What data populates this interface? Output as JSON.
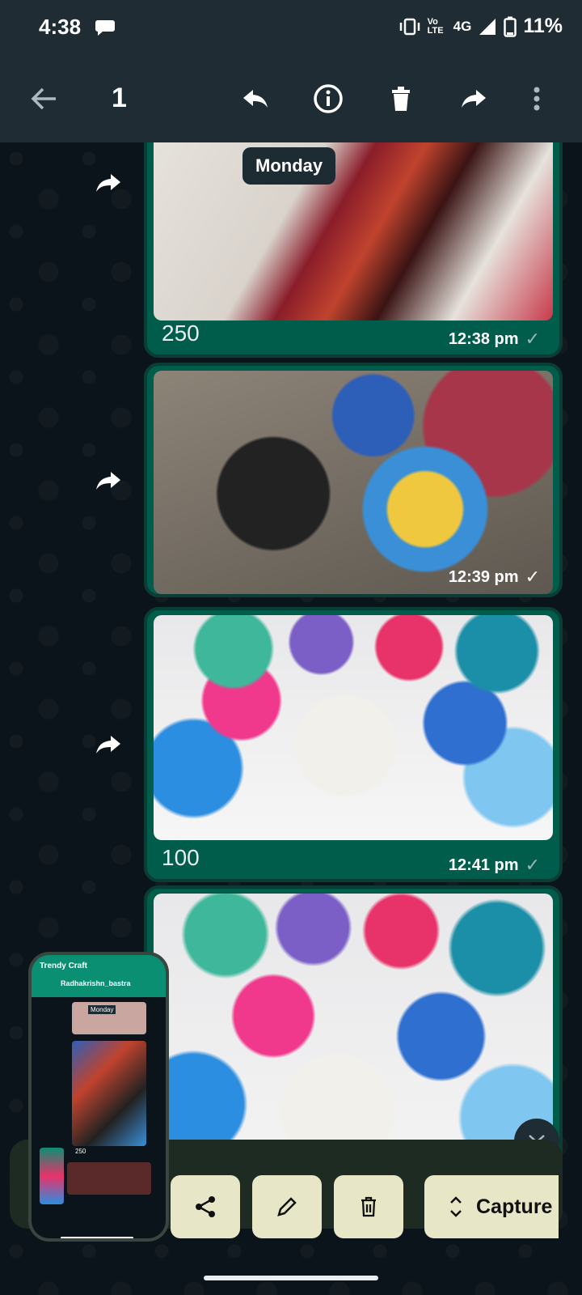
{
  "status_bar": {
    "time": "4:38",
    "network": "4G",
    "volte": "Vo LTE",
    "battery": "11%"
  },
  "app_bar": {
    "selected_count": "1"
  },
  "date_chip": "Monday",
  "messages": [
    {
      "caption": "250",
      "time": "12:38 pm"
    },
    {
      "caption": "",
      "time": "12:39 pm"
    },
    {
      "caption": "100",
      "time": "12:41 pm"
    },
    {
      "caption": "",
      "time": ""
    }
  ],
  "thumbnail": {
    "app_title": "Trendy Craft",
    "chat_name": "Radhakrishn_bastra",
    "date": "Monday",
    "caption": "250"
  },
  "actions": {
    "capture_label": "Capture"
  },
  "colors": {
    "bubble": "#005c4b",
    "header": "#1f2c34",
    "button": "#e7e7c8"
  }
}
